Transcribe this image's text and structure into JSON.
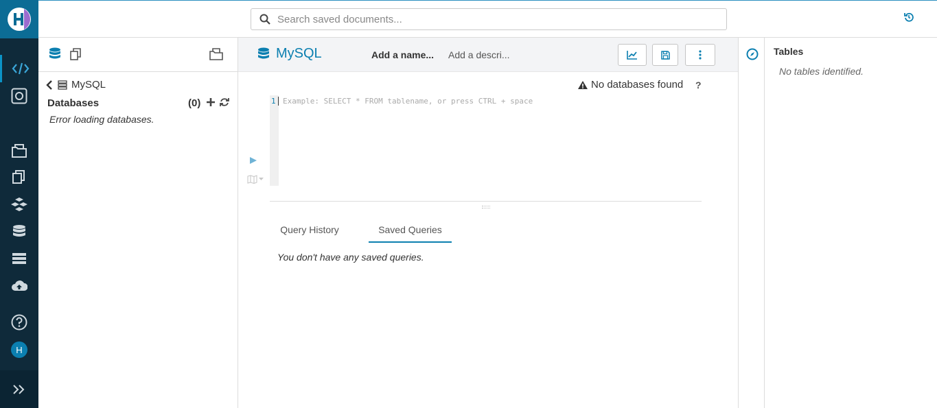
{
  "search": {
    "placeholder": "Search saved documents..."
  },
  "assist": {
    "breadcrumb": "MySQL",
    "databases_title": "Databases",
    "databases_count": "(0)",
    "error": "Error loading databases."
  },
  "editor": {
    "title": "MySQL",
    "name_placeholder": "Add a name...",
    "description_placeholder": "Add a descri...",
    "status": "No databases found",
    "help": "?",
    "line_number": "1",
    "placeholder": "Example: SELECT * FROM tablename, or press CTRL + space",
    "tabs": [
      {
        "label": "Query History",
        "active": false
      },
      {
        "label": "Saved Queries",
        "active": true
      }
    ],
    "saved_empty": "You don't have any saved queries."
  },
  "right_assist": {
    "title": "Tables",
    "empty": "No tables identified."
  },
  "user": {
    "initial": "H"
  },
  "colors": {
    "accent": "#0b7fb0",
    "rail": "#0f2a3a",
    "logo_bg": "#0c6c95"
  },
  "icons": [
    "hue-logo-icon",
    "code-editor-icon",
    "dashboard-icon",
    "documents-icon",
    "files-icon",
    "tables-icon",
    "database-icon",
    "jobs-icon",
    "importer-icon",
    "help-icon",
    "expand-icon",
    "history-icon",
    "search-icon",
    "database-icon",
    "docs-icon",
    "folder-icon",
    "back-icon",
    "server-icon",
    "add-icon",
    "refresh-icon",
    "chart-icon",
    "save-icon",
    "more-icon",
    "warning-icon",
    "play-icon",
    "map-icon",
    "compass-icon"
  ]
}
